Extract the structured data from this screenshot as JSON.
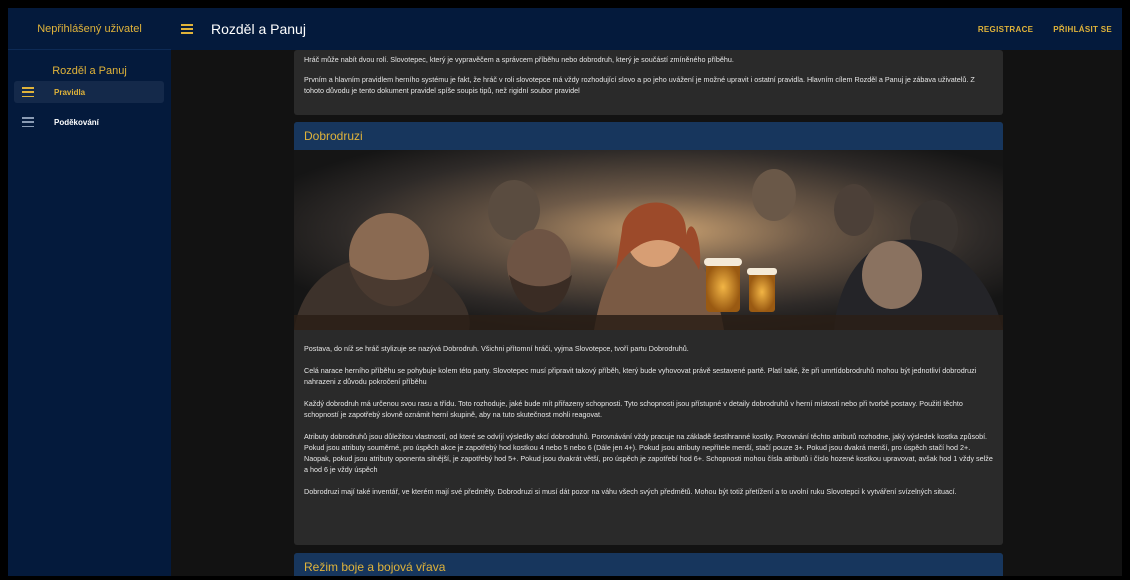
{
  "sidebar": {
    "header": "Nepřihlášený uživatel",
    "section_title": "Rozděl a Panuj",
    "items": [
      {
        "label": "Pravidla",
        "active": true
      },
      {
        "label": "Poděkování",
        "active": false
      }
    ]
  },
  "appbar": {
    "title": "Rozděl a Panuj",
    "register_label": "REGISTRACE",
    "login_label": "PŘIHLÁSIT SE"
  },
  "intro": {
    "p1": "Hráč může nabít dvou rolí. Slovotepec, který je vypravěčem a správcem příběhu nebo dobrodruh, který je součástí zmíněného příběhu.",
    "p2": "Prvním a hlavním pravidlem herního systému je fakt, že hráč v roli slovotepce má vždy rozhodující slovo a po jeho uvážení je možné upravit i ostatní pravidla. Hlavním cílem Rozděl a Panuj je zábava uživatelů. Z tohoto důvodu je tento dokument pravidel spíše soupis tipů, než rigidní soubor pravidel"
  },
  "adventurers": {
    "title": "Dobrodruzi",
    "p1": "Postava, do níž se hráč stylizuje se nazývá Dobrodruh. Všichni přítomní hráči, vyjma Slovotepce, tvoří partu Dobrodruhů.",
    "p2": "Celá narace herního příběhu se pohybuje kolem této party. Slovotepec musí připravit takový příběh, který bude vyhovovat právě sestavené partě. Platí také, že při umrtídobrodruhů mohou být jednotliví dobrodruzi nahrazeni z důvodu pokročení příběhu",
    "p3": "Každý dobrodruh má určenou svou rasu a třídu. Toto rozhoduje, jaké bude mít přiřazeny schopnosti. Tyto schopnosti jsou přístupné v detaily dobrodruhů v herní místosti nebo při tvorbě postavy. Použití těchto schopností je zapotřebý slovně oznámit herní skupině, aby na tuto skutečnost mohli reagovat.",
    "p4": "Atributy dobrodruhů jsou důležitou vlastností, od které se odvíjí výsledky akcí dobrodruhů. Porovnávání vždy pracuje na základě šestihranné kostky. Porovnání těchto atributů rozhodne, jaký výsledek kostka způsobí. Pokud jsou atributy souměrné, pro úspěch akce je zapotřebý hod kostkou 4 nebo 5 nebo 6 (Dále jen 4+). Pokud jsou atributy nepřítele menší, stačí pouze 3+. Pokud jsou dvakrá menší, pro úspěch stačí hod 2+. Naopak, pokud jsou atributy oponenta silnější, je zapotřebý hod 5+. Pokud jsou dvakrát větší, pro úspěch je zapotřebí hod 6+. Schopnosti mohou čísla atributů i číslo hozené kostkou upravovat, avšak hod 1 vždy selže a hod 6 je vždy úspěch",
    "p5": "Dobrodruzi mají také inventář, ve kterém mají své předměty. Dobrodruzi si musí dát pozor na váhu všech svých předmětů. Mohou být totiž přetížení a to uvolní ruku Slovotepci k vytváření svízelných situací."
  },
  "combat": {
    "title": "Režim boje a bojová vřava"
  },
  "colors": {
    "accent": "#e0b33a",
    "navy": "#041a3c",
    "card_header": "#17365d",
    "card_bg": "#2a2a2a"
  },
  "icons": {
    "nav_item": "list-icon",
    "menu": "hamburger-icon"
  }
}
